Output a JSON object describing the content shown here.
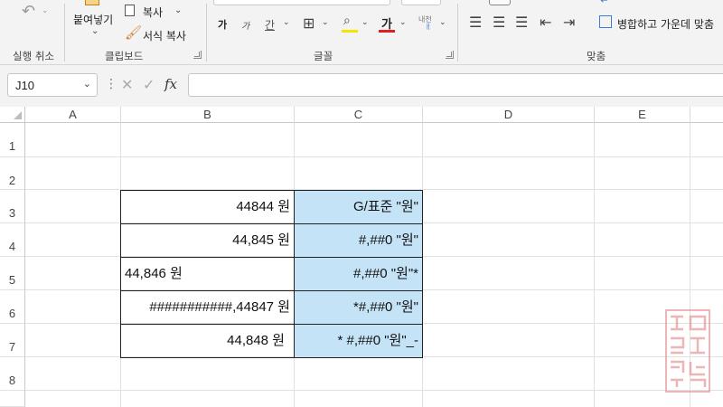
{
  "ribbon": {
    "undo_group_label": "실행 취소",
    "clipboard": {
      "label": "클립보드",
      "paste_label": "붙여넣기",
      "copy_label": "복사",
      "format_painter_label": "서식 복사"
    },
    "font": {
      "label": "글꼴",
      "increase_size_label": "가",
      "decrease_size_label": "가",
      "underline_label": "간",
      "font_color_label": "가",
      "phonetic_label": "내천"
    },
    "alignment": {
      "label": "맞춤",
      "merge_label": "병합하고 가운데 맞춤"
    }
  },
  "formula_bar": {
    "name_box": "J10",
    "fx_label": "fx",
    "formula": ""
  },
  "columns": [
    "A",
    "B",
    "C",
    "D",
    "E"
  ],
  "rows": [
    "1",
    "2",
    "3",
    "4",
    "5",
    "6",
    "7",
    "8"
  ],
  "cells": [
    {
      "row": 3,
      "b": "44844 원",
      "b_align": "right",
      "c": "G/표준 \"원\""
    },
    {
      "row": 4,
      "b": "44,845 원",
      "b_align": "right",
      "c": "#,##0 \"원\""
    },
    {
      "row": 5,
      "b": "44,846 원",
      "b_align": "left",
      "c": "#,##0 \"원\"*"
    },
    {
      "row": 6,
      "b": "###########,44847 원",
      "b_align": "right",
      "c": "*#,##0 \"원\""
    },
    {
      "row": 7,
      "b": "44,848 원",
      "b_align": "right",
      "c": "* #,##0 \"원\"_-"
    }
  ],
  "colors": {
    "format_cell_bg": "#c5e3f7",
    "border": "#222222",
    "font_color_bar": "#e02020",
    "fill_color_bar": "#f5e600"
  }
}
